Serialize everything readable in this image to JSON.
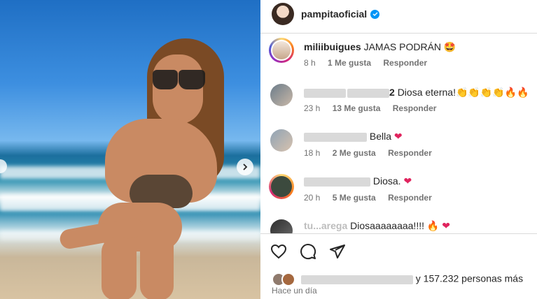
{
  "post": {
    "username": "pampitaoficial",
    "verified": true,
    "accent": "#0095f6"
  },
  "comments": [
    {
      "username": "miliibuigues",
      "text": "JAMAS PODRÁN 🤩",
      "time": "8 h",
      "likes": "1 Me gusta",
      "reply": "Responder"
    },
    {
      "username_suffix": "2",
      "text": "Diosa eterna!👏👏👏👏🔥🔥",
      "time": "23 h",
      "likes": "13 Me gusta",
      "reply": "Responder"
    },
    {
      "text": "Bella",
      "emoji": "❤",
      "time": "18 h",
      "likes": "2 Me gusta",
      "reply": "Responder"
    },
    {
      "text": "Diosa.",
      "emoji": "❤",
      "time": "20 h",
      "likes": "5 Me gusta",
      "reply": "Responder"
    },
    {
      "username_visible": "tu...arega",
      "text": "Diosaaaaaaaa!!!! 🔥",
      "emoji": "❤"
    }
  ],
  "likes_summary": {
    "tail": "y 157.232 personas más"
  },
  "timestamp": "Hace un día"
}
